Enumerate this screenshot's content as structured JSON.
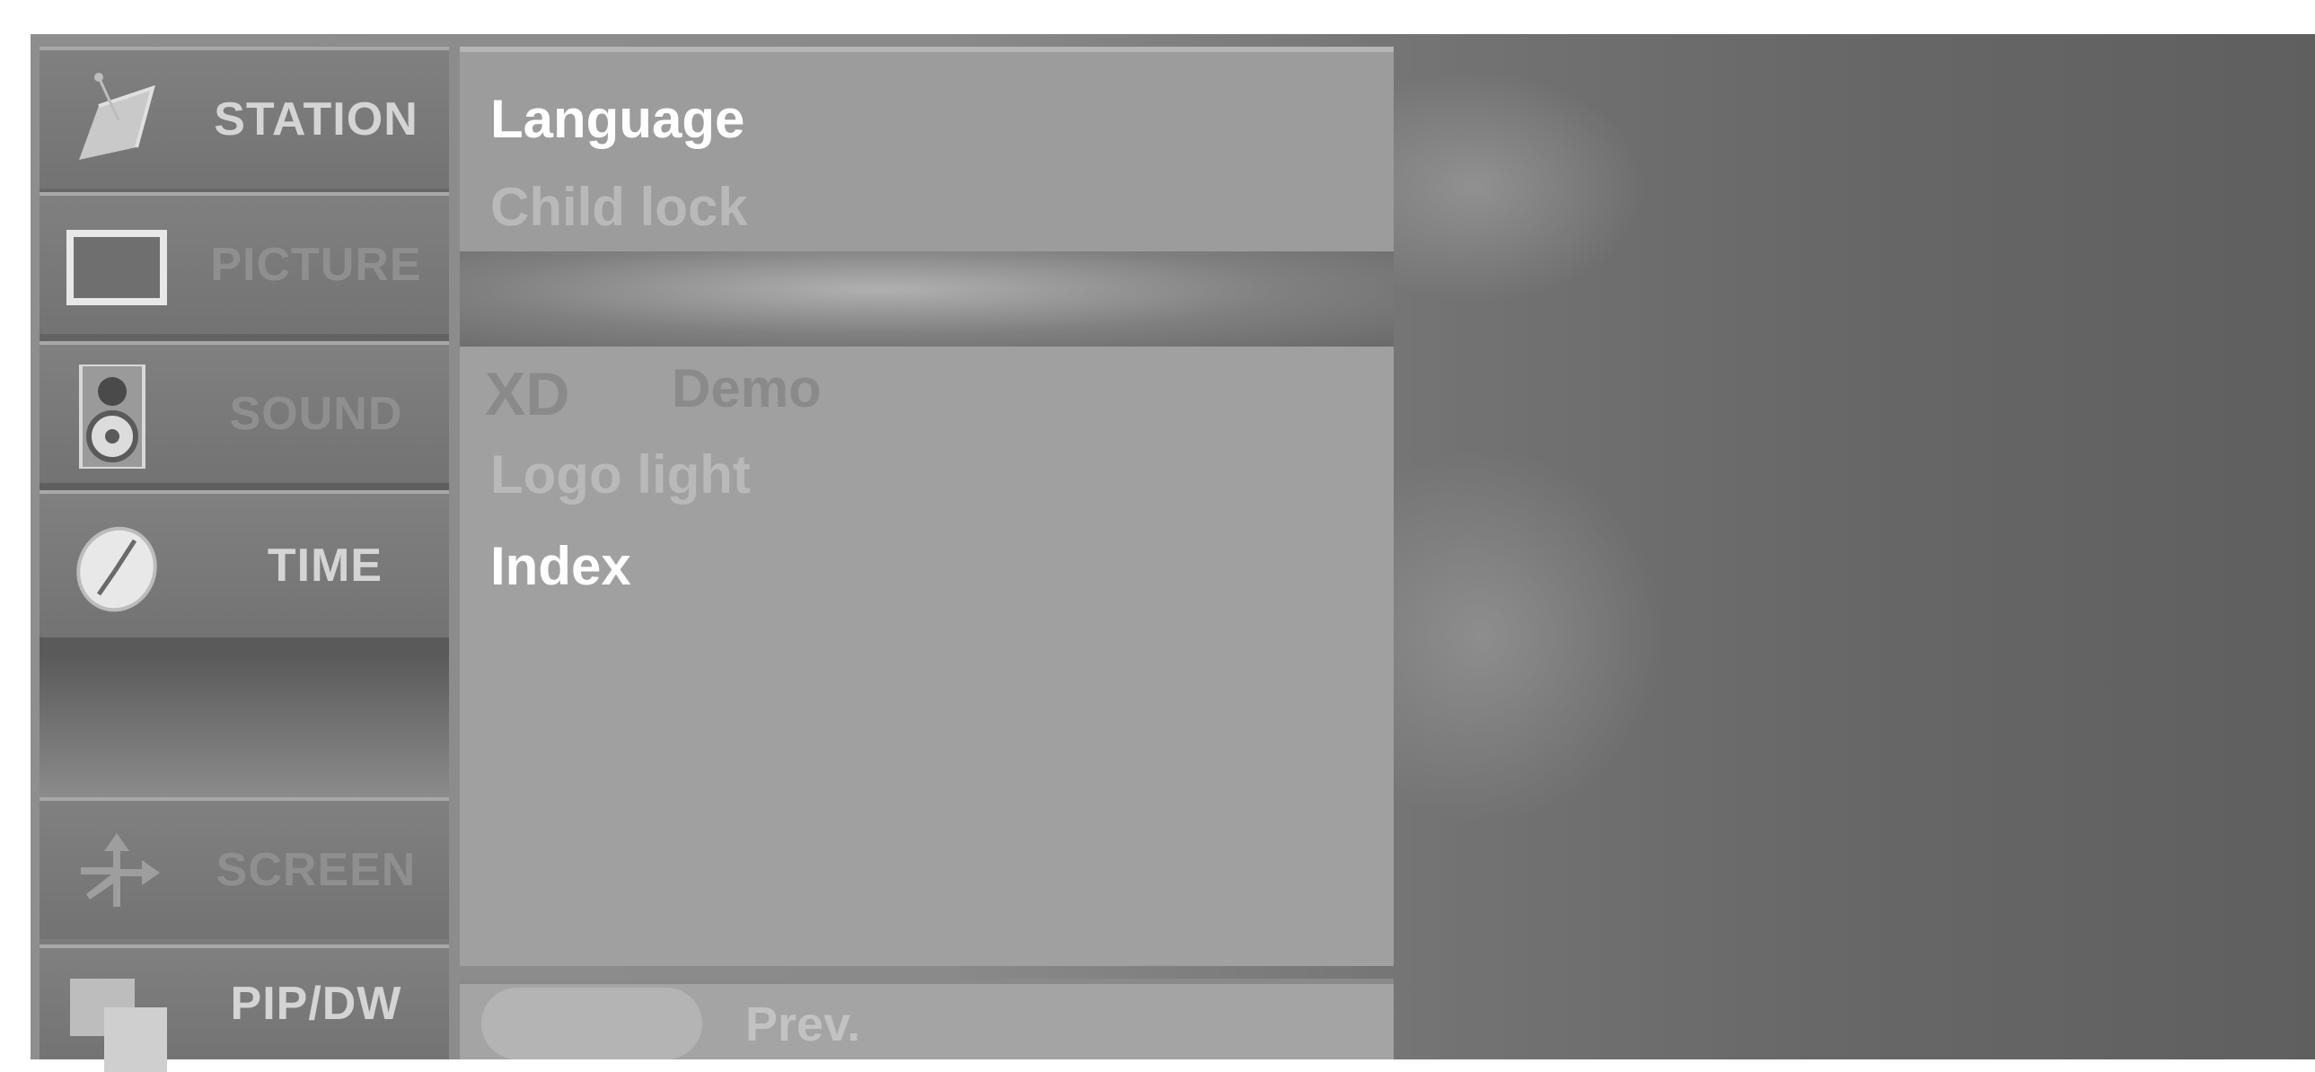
{
  "sidebar": {
    "tabs": [
      {
        "label": "STATION",
        "icon": "satellite-dish-icon"
      },
      {
        "label": "PICTURE",
        "icon": "tv-screen-icon"
      },
      {
        "label": "SOUND",
        "icon": "speaker-icon"
      },
      {
        "label": "TIME",
        "icon": "clock-icon"
      },
      {
        "label": "SCREEN",
        "icon": "move-arrows-icon"
      },
      {
        "label": "PIP/DW",
        "icon": "pip-windows-icon"
      }
    ]
  },
  "menu": {
    "items": [
      {
        "label": "Language"
      },
      {
        "label": "Child lock"
      },
      {
        "label": "Demo",
        "logo": "XD"
      },
      {
        "label": "Logo light"
      },
      {
        "label": "Index"
      }
    ]
  },
  "footer": {
    "prev_label": "Prev."
  }
}
